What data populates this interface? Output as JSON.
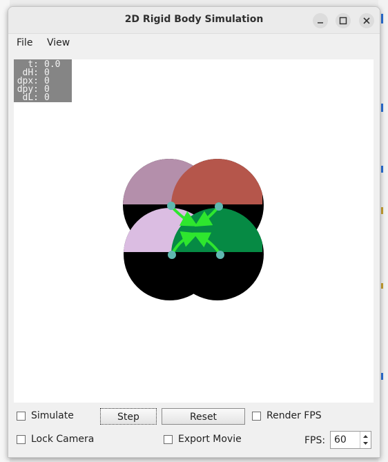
{
  "window": {
    "title": "2D Rigid Body Simulation"
  },
  "menu": {
    "file": "File",
    "view": "View"
  },
  "hud": [
    {
      "label": "t:",
      "value": "0.0"
    },
    {
      "label": "dH:",
      "value": "0"
    },
    {
      "label": "dpx:",
      "value": "0"
    },
    {
      "label": "dpy:",
      "value": "0"
    },
    {
      "label": "dL:",
      "value": "0"
    }
  ],
  "bodies": [
    {
      "name": "mauve",
      "color": "#b48fab"
    },
    {
      "name": "red",
      "color": "#b5564b"
    },
    {
      "name": "lavender",
      "color": "#dbbde2"
    },
    {
      "name": "green",
      "color": "#068a44"
    }
  ],
  "colors": {
    "body_bottom": "#000000",
    "force_arrow": "#2ee62e",
    "contact_point": "#5fb8b0"
  },
  "controls": {
    "simulate": "Simulate",
    "step": "Step",
    "reset": "Reset",
    "render_fps": "Render FPS",
    "lock_camera": "Lock Camera",
    "export_movie": "Export Movie",
    "fps_label": "FPS:",
    "fps_value": "60"
  }
}
